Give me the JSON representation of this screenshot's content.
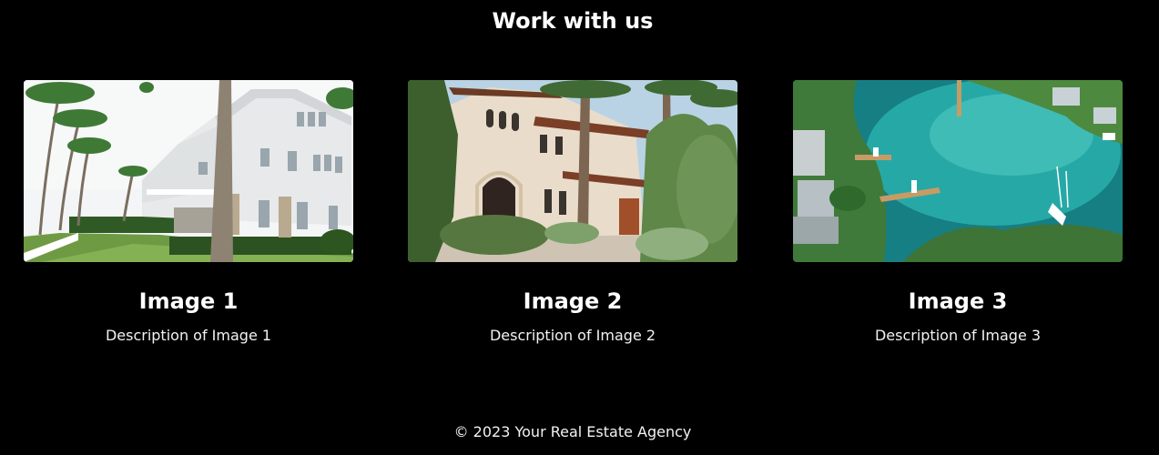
{
  "section": {
    "title": "Work with us"
  },
  "cards": [
    {
      "title": "Image 1",
      "description": "Description of Image 1"
    },
    {
      "title": "Image 2",
      "description": "Description of Image 2"
    },
    {
      "title": "Image 3",
      "description": "Description of Image 3"
    }
  ],
  "footer": {
    "text": "© 2023 Your Real Estate Agency"
  },
  "colors": {
    "background": "#000000",
    "text": "#ffffff"
  }
}
